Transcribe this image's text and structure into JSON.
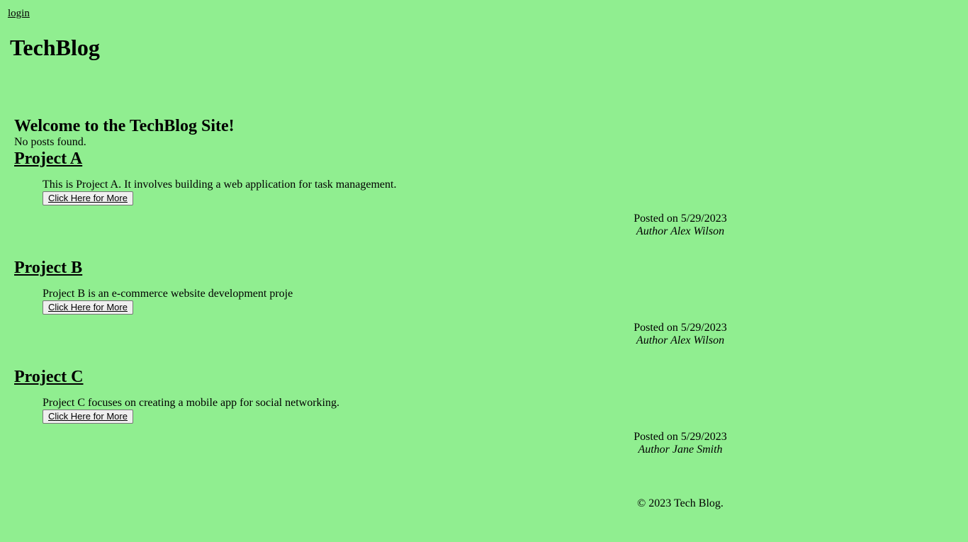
{
  "nav": {
    "login_label": "login"
  },
  "site": {
    "title": "TechBlog"
  },
  "main": {
    "welcome": "Welcome to the TechBlog Site!",
    "no_posts": "No posts found."
  },
  "posts": [
    {
      "title": "Project A",
      "description": "This is Project A. It involves building a web application for task management.",
      "button_label": "Click Here for More",
      "posted_on": "Posted on 5/29/2023",
      "author": "Author Alex Wilson"
    },
    {
      "title": "Project B",
      "description": "Project B is an e-commerce website development proje",
      "button_label": "Click Here for More",
      "posted_on": "Posted on 5/29/2023",
      "author": "Author Alex Wilson"
    },
    {
      "title": "Project C",
      "description": "Project C focuses on creating a mobile app for social networking.",
      "button_label": "Click Here for More",
      "posted_on": "Posted on 5/29/2023",
      "author": "Author Jane Smith"
    }
  ],
  "footer": {
    "copyright": "© 2023 Tech Blog."
  },
  "colors": {
    "background": "#90ee90",
    "text": "#000000"
  }
}
